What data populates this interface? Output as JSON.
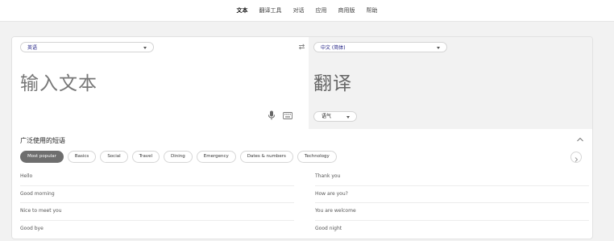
{
  "nav": {
    "items": [
      {
        "label": "文本",
        "active": true
      },
      {
        "label": "翻译工具",
        "active": false
      },
      {
        "label": "对话",
        "active": false
      },
      {
        "label": "应用",
        "active": false
      },
      {
        "label": "商用版",
        "active": false
      },
      {
        "label": "帮助",
        "active": false
      }
    ]
  },
  "source": {
    "language": "英语",
    "placeholder": "输入文本",
    "icons": [
      "microphone-icon",
      "keyboard-icon"
    ]
  },
  "swap_icon": "swap-arrows-icon",
  "target": {
    "language": "中文 (简体)",
    "placeholder": "翻译",
    "tone": "语气"
  },
  "phrases": {
    "title": "广泛使用的短语",
    "categories": [
      {
        "label": "Most popular",
        "active": true
      },
      {
        "label": "Basics",
        "active": false
      },
      {
        "label": "Social",
        "active": false
      },
      {
        "label": "Travel",
        "active": false
      },
      {
        "label": "Dining",
        "active": false
      },
      {
        "label": "Emergency",
        "active": false
      },
      {
        "label": "Dates & numbers",
        "active": false
      },
      {
        "label": "Technology",
        "active": false
      }
    ],
    "left": [
      "Hello",
      "Good morning",
      "Nice to meet you",
      "Good bye"
    ],
    "right": [
      "Thank you",
      "How are you?",
      "You are welcome",
      "Good night"
    ]
  }
}
